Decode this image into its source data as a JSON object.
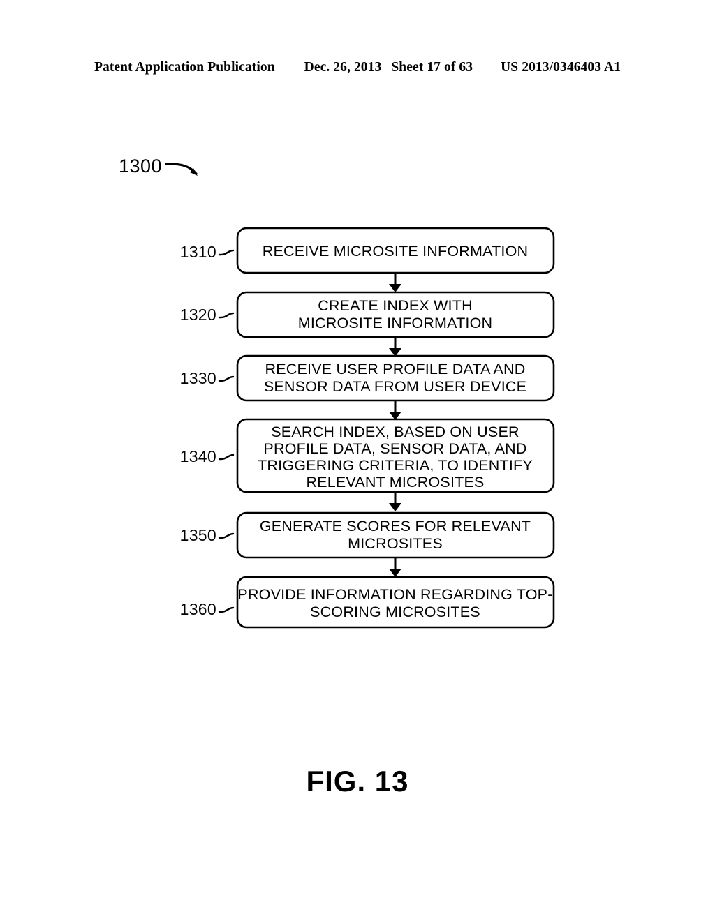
{
  "header": {
    "publication": "Patent Application Publication",
    "date": "Dec. 26, 2013",
    "sheet": "Sheet 17 of 63",
    "patent_number": "US 2013/0346403 A1"
  },
  "figure": {
    "caption": "FIG. 13",
    "process_ref": "1300",
    "steps": [
      {
        "ref": "1310",
        "lines": [
          "RECEIVE MICROSITE INFORMATION"
        ]
      },
      {
        "ref": "1320",
        "lines": [
          "CREATE INDEX WITH",
          "MICROSITE INFORMATION"
        ]
      },
      {
        "ref": "1330",
        "lines": [
          "RECEIVE USER PROFILE DATA AND",
          "SENSOR DATA FROM USER DEVICE"
        ]
      },
      {
        "ref": "1340",
        "lines": [
          "SEARCH INDEX, BASED ON USER",
          "PROFILE DATA, SENSOR DATA, AND",
          "TRIGGERING CRITERIA, TO IDENTIFY",
          "RELEVANT MICROSITES"
        ]
      },
      {
        "ref": "1350",
        "lines": [
          "GENERATE SCORES FOR RELEVANT",
          "MICROSITES"
        ]
      },
      {
        "ref": "1360",
        "lines": [
          "PROVIDE INFORMATION REGARDING TOP-",
          "SCORING MICROSITES"
        ]
      }
    ]
  },
  "colors": {
    "ink": "#000000",
    "paper": "#ffffff"
  }
}
